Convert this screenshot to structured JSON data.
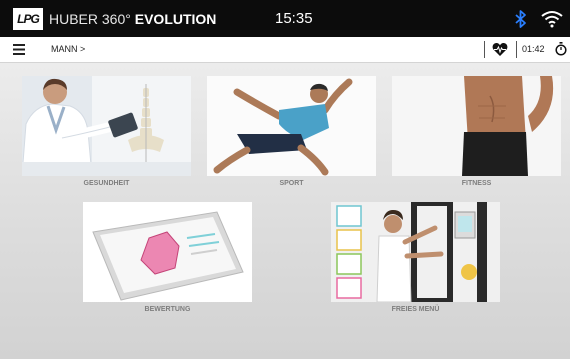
{
  "header": {
    "logo_text": "LPG",
    "brand_normal": "HUBER 360°",
    "brand_bold": "EVOLUTION",
    "time": "15:35",
    "icons": [
      "bluetooth-icon",
      "wifi-icon"
    ]
  },
  "subbar": {
    "breadcrumb": "MANN >",
    "timer": "01:42",
    "icons": [
      "menu-icon",
      "heart-rate-icon",
      "stopwatch-icon"
    ]
  },
  "tiles": [
    {
      "label": "GESUNDHEIT"
    },
    {
      "label": "SPORT"
    },
    {
      "label": "FITNESS"
    },
    {
      "label": "BEWERTUNG"
    },
    {
      "label": "FREIES MENÜ"
    }
  ],
  "colors": {
    "header_bg": "#0c0c0c",
    "bluetooth": "#2a7fff",
    "accent_pink": "#e86aa0",
    "tablet_aqua": "#7fd0d8"
  }
}
